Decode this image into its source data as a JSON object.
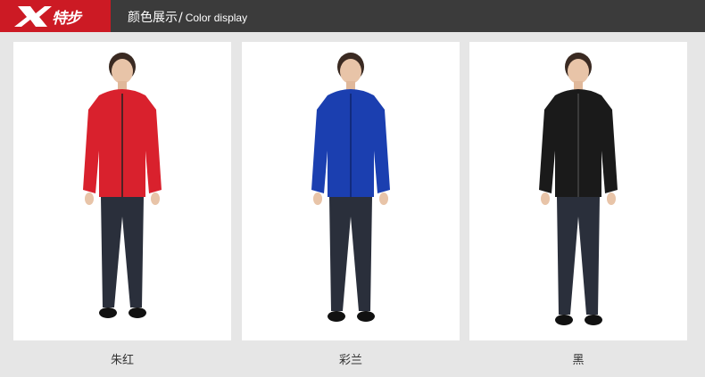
{
  "brand": {
    "logo_text": "特步",
    "accent_color": "#cc1a24"
  },
  "header": {
    "title_cn": "颜色展示",
    "separator": "/",
    "title_en": "Color display",
    "background": "#3b3b3b"
  },
  "colors": [
    {
      "label": "朱红",
      "jacket_color": "#d9212d",
      "icon": "model-red-jacket-image"
    },
    {
      "label": "彩兰",
      "jacket_color": "#1b3fb0",
      "icon": "model-blue-jacket-image"
    },
    {
      "label": "黑",
      "jacket_color": "#1a1a1a",
      "icon": "model-black-jacket-image"
    }
  ]
}
